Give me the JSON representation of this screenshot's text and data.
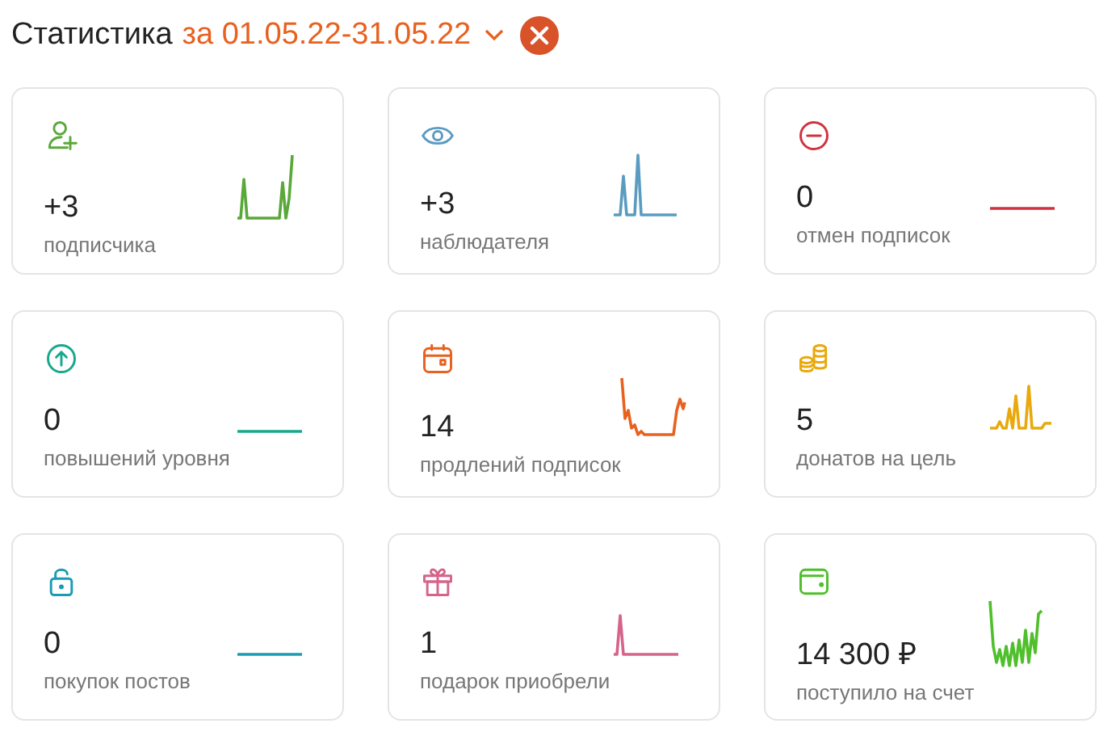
{
  "header": {
    "title": "Статистика",
    "period": "за 01.05.22-31.05.22"
  },
  "cards": [
    {
      "kind": "user-plus",
      "color": "#5aa83a",
      "value": "+3",
      "label": "подписчика"
    },
    {
      "kind": "eye",
      "color": "#5b9bc0",
      "value": "+3",
      "label": "наблюдателя"
    },
    {
      "kind": "minus",
      "color": "#d0323f",
      "value": "0",
      "label": "отмен подписок"
    },
    {
      "kind": "arrow-up",
      "color": "#16a88d",
      "value": "0",
      "label": "повышений уровня"
    },
    {
      "kind": "calendar",
      "color": "#e8611f",
      "value": "14",
      "label": "продлений подписок"
    },
    {
      "kind": "coins",
      "color": "#e9a90c",
      "value": "5",
      "label": "донатов на цель"
    },
    {
      "kind": "lock",
      "color": "#1a9bb3",
      "value": "0",
      "label": "покупок постов"
    },
    {
      "kind": "gift",
      "color": "#d5648a",
      "value": "1",
      "label": "подарок приобрели"
    },
    {
      "kind": "wallet",
      "color": "#4fbf2b",
      "value": "14 300 ₽",
      "label": "поступило на счет"
    }
  ]
}
